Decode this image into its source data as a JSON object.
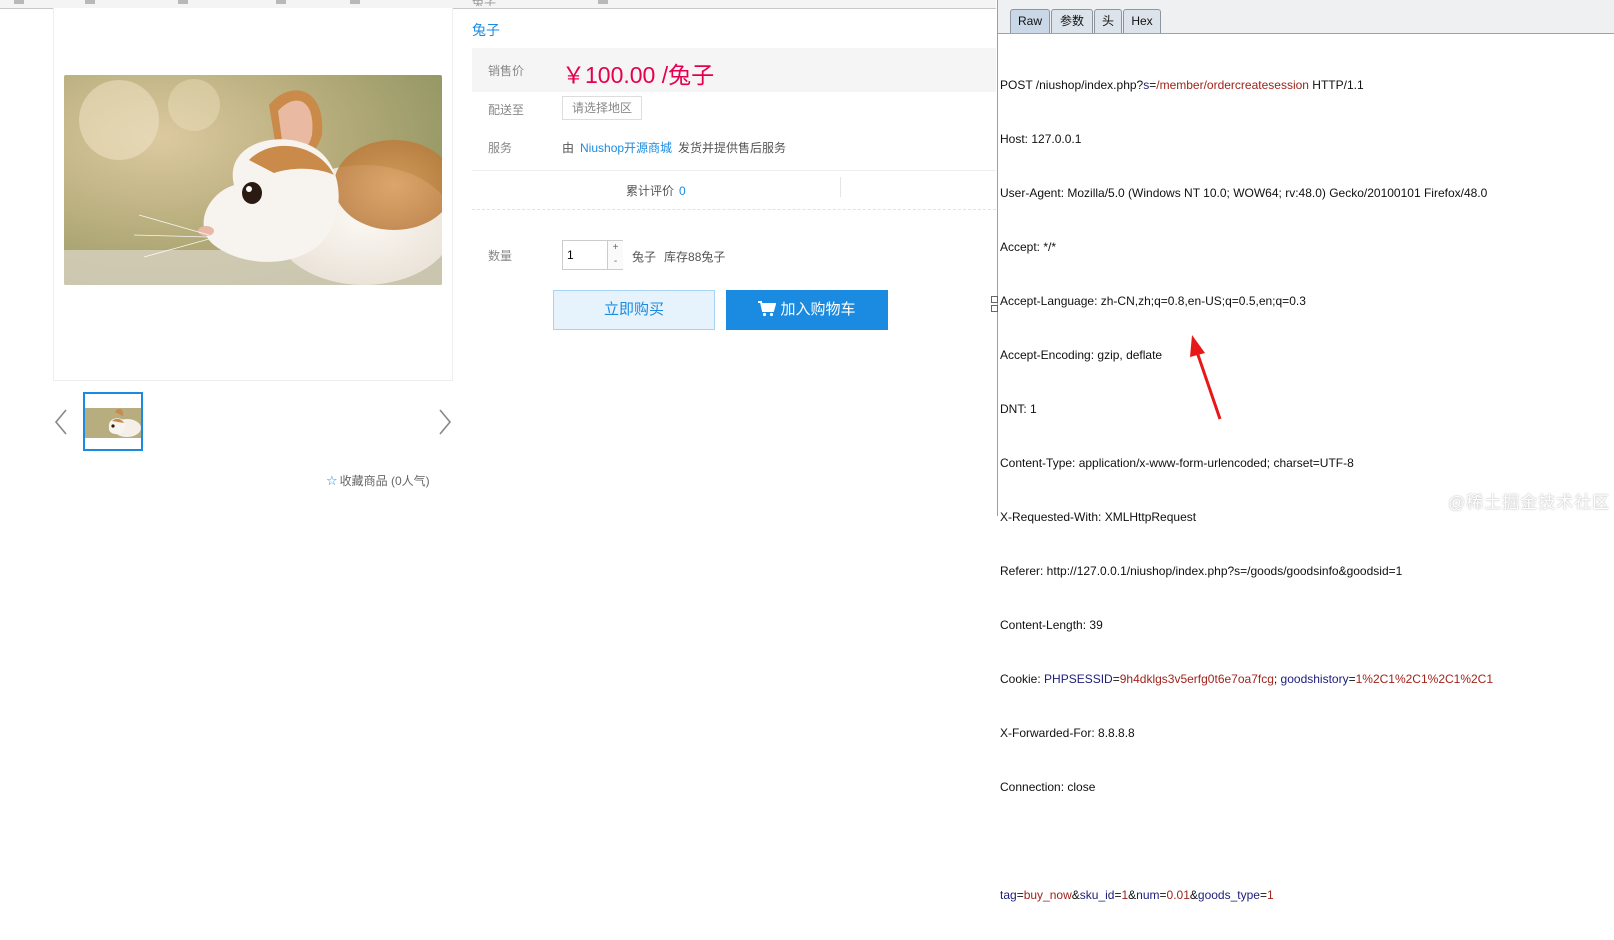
{
  "product": {
    "title_partial": "兔子",
    "name": "兔子",
    "price_label": "销售价",
    "price": "￥100.00 /兔子",
    "region_label": "配送至",
    "region_placeholder": "请选择地区",
    "service_label": "服务",
    "service_prefix": "由",
    "service_shop": "Niushop开源商城",
    "service_suffix": "发货并提供售后服务",
    "review_label": "累计评价",
    "review_count": "0",
    "quantity_label": "数量",
    "quantity_value": "1",
    "qty_plus": "+",
    "qty_minus": "-",
    "unit": "兔子",
    "stock": "库存88兔子",
    "buy_now": "立即购买",
    "add_to_cart": "加入购物车",
    "favorite": "收藏商品 (0人气)"
  },
  "burp": {
    "tabs": [
      "Raw",
      "参数",
      "头",
      "Hex"
    ],
    "active_tab": "Raw",
    "request_line": {
      "method": "POST /niushop/index.php?",
      "param_key": "s",
      "param_value": "/member/ordercreatesession",
      "protocol": " HTTP/1.1"
    },
    "headers": [
      "Host: 127.0.0.1",
      "User-Agent: Mozilla/5.0 (Windows NT 10.0; WOW64; rv:48.0) Gecko/20100101 Firefox/48.0",
      "Accept: */*",
      "Accept-Language: zh-CN,zh;q=0.8,en-US;q=0.5,en;q=0.3",
      "Accept-Encoding: gzip, deflate",
      "DNT: 1",
      "Content-Type: application/x-www-form-urlencoded; charset=UTF-8",
      "X-Requested-With: XMLHttpRequest",
      "Referer: http://127.0.0.1/niushop/index.php?s=/goods/goodsinfo&goodsid=1",
      "Content-Length: 39"
    ],
    "cookie": {
      "prefix": "Cookie: ",
      "k1": "PHPSESSID",
      "v1": "9h4dklgs3v5erfg0t6e7oa7fcg",
      "sep": "; ",
      "k2": "goodshistory",
      "v2": "1%2C1%2C1%2C1%2C1"
    },
    "headers_after": [
      "X-Forwarded-For: 8.8.8.8",
      "Connection: close"
    ],
    "body": [
      {
        "k": "tag",
        "v": "buy_now"
      },
      {
        "k": "sku_id",
        "v": "1"
      },
      {
        "k": "num",
        "v": "0.01"
      },
      {
        "k": "goods_type",
        "v": "1"
      }
    ]
  },
  "watermark": "@稀土掘金技术社区",
  "colors": {
    "accent_blue": "#1a8be0",
    "price_red": "#e5004f",
    "annotation_red": "#e81818",
    "burp_key": "#1c1c7c",
    "burp_value": "#a0241c"
  },
  "icons": [
    "star-icon",
    "cart-icon",
    "chevron-left-icon",
    "chevron-right-icon",
    "red-arrow"
  ]
}
